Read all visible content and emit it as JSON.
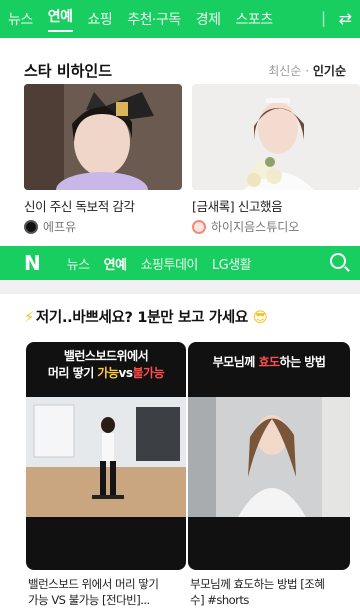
{
  "top_tabs": [
    "뉴스",
    "연예",
    "쇼핑",
    "추천·구독",
    "경제",
    "스포츠"
  ],
  "top_active_tab": "연예",
  "star_section": {
    "title": "스타 비하인드",
    "sort_latest": "최신순",
    "sort_separator": "·",
    "sort_popular": "인기순",
    "cards": [
      {
        "title": "신이 주신 독보적 감각",
        "source": "에프유",
        "source_color": "#111111"
      },
      {
        "title": "[금새록] 신고했음",
        "source": "하이지음스튜디오",
        "source_color": "#f08a7a"
      }
    ]
  },
  "nav2": {
    "logo": "N",
    "tabs": [
      "뉴스",
      "연예",
      "쇼핑투데이",
      "LG생활"
    ],
    "active_tab": "연예"
  },
  "shorts_section": {
    "bolt": "⚡",
    "title": "저기..바쁘세요? 1분만 보고 가세요",
    "emoji": "😎",
    "videos": [
      {
        "head_line1": "밸런스보드위에서",
        "head_line2_a": "머리 땋기 ",
        "head_line2_b": "가능",
        "head_line2_c": "vs",
        "head_line2_d": "불가능",
        "caption_line1": "밸런스보드 위에서 머리 땋기",
        "caption_line2": "가능 VS 불가능 [전다빈]..."
      },
      {
        "head_line1_a": "부모님께 ",
        "head_line1_b": "효도",
        "head_line1_c": "하는 방법",
        "caption_line1": "부모님께 효도하는 방법 [조혜",
        "caption_line2": "수] #shorts"
      }
    ]
  },
  "colors": {
    "naver_green": "#19ce60"
  }
}
